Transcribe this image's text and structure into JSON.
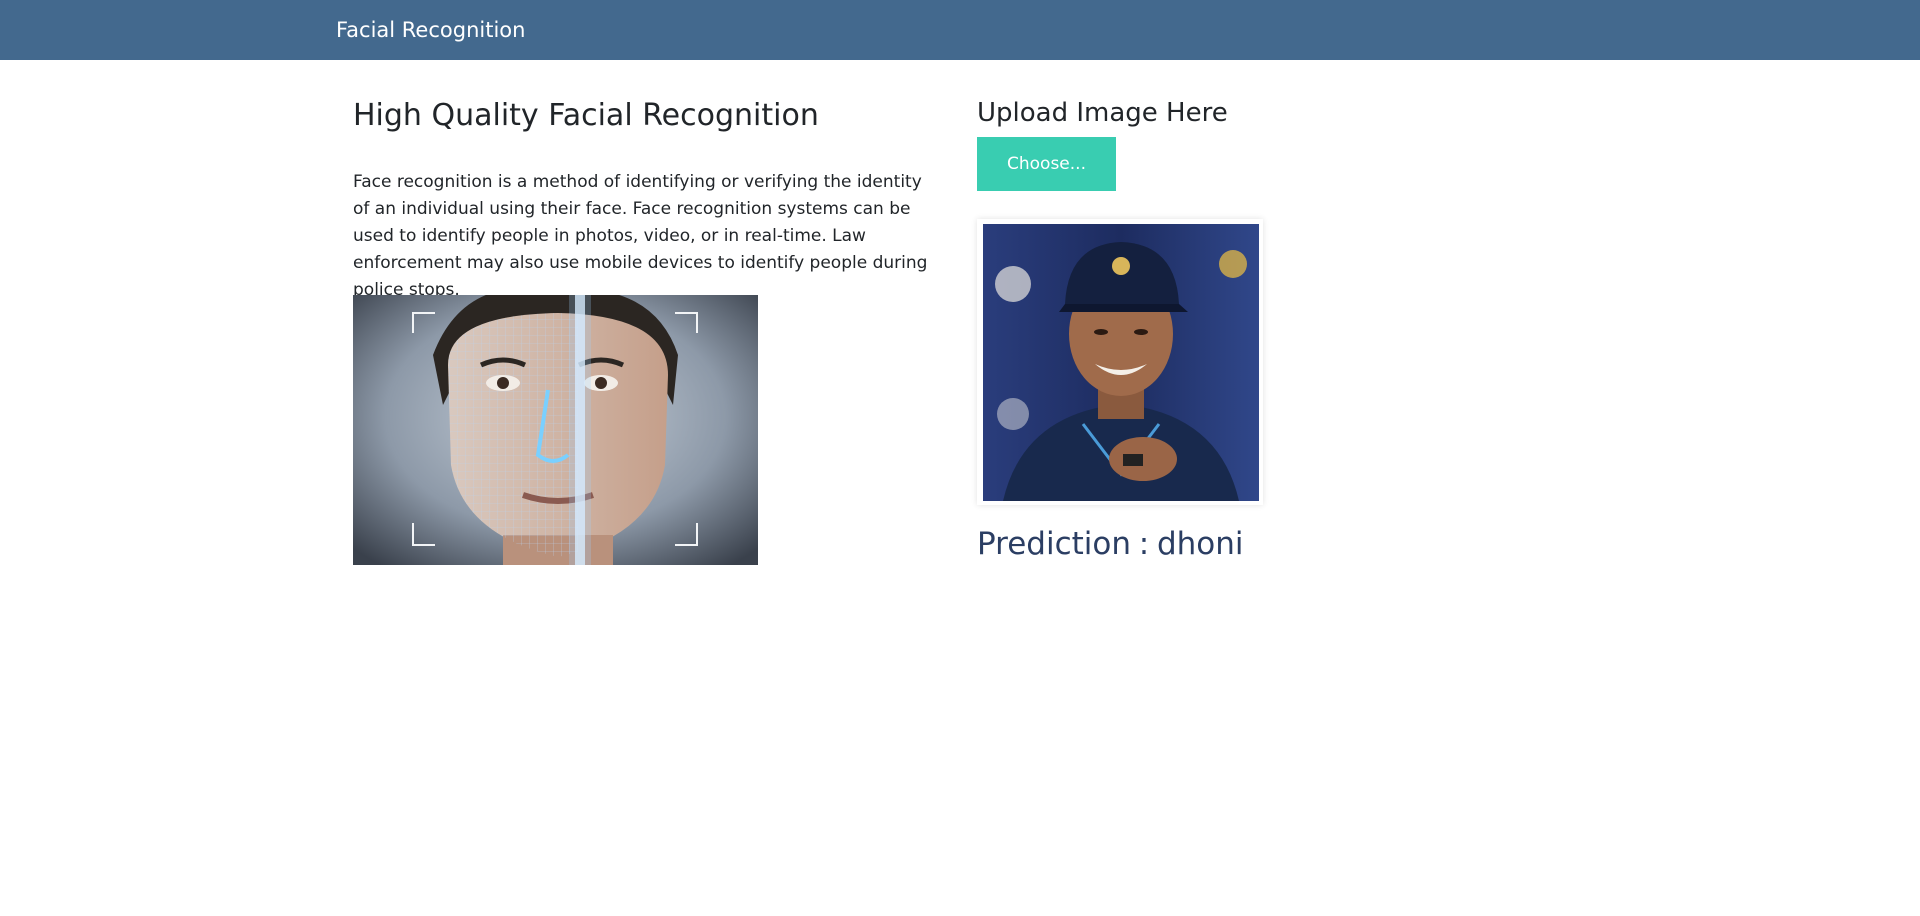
{
  "navbar": {
    "brand": "Facial Recognition"
  },
  "main": {
    "title": "High Quality Facial Recognition",
    "description": "Face recognition is a method of identifying or verifying the identity of an individual using their face. Face recognition systems can be used to identify people in photos, video, or in real-time. Law enforcement may also use mobile devices to identify people during police stops."
  },
  "upload": {
    "title": "Upload Image Here",
    "button_label": "Choose..."
  },
  "prediction": {
    "label": "Prediction",
    "separator": ":",
    "value": "dhoni"
  },
  "colors": {
    "navbar": "#43698e",
    "button": "#39cdb1",
    "prediction_text": "#2b3e63"
  }
}
